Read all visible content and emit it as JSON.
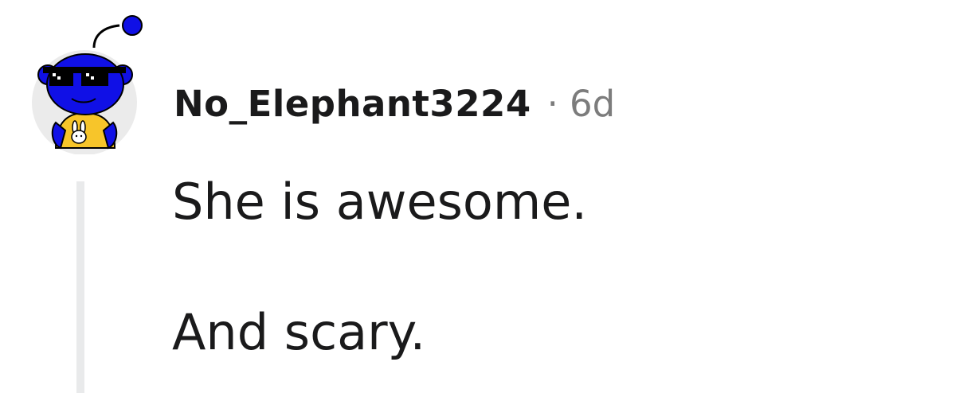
{
  "comment": {
    "username": "No_Elephant3224",
    "separator": "·",
    "age": "6d",
    "body": [
      "She is awesome.",
      "And scary."
    ]
  },
  "avatar": {
    "icon": "reddit-snoo-avatar-icon",
    "colors": {
      "circle_bg": "#ebebeb",
      "head": "#1010e6",
      "shirt": "#f7c52a",
      "sunglasses": "#000000"
    }
  },
  "colors": {
    "username": "#1a1a1b",
    "meta": "#7c7c7c",
    "body_text": "#1a1a1b",
    "thread_line": "#e9eaeb"
  }
}
